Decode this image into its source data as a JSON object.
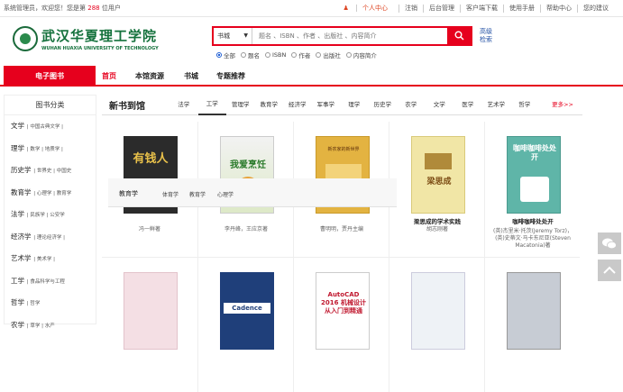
{
  "topbar": {
    "welcome_prefix": "系统管理员，欢迎您！您是第",
    "visit_count": "288",
    "welcome_suffix": "位用户",
    "links": [
      "个人中心",
      "注销",
      "后台管理",
      "客户端下载",
      "使用手册",
      "帮助中心",
      "您的建议"
    ]
  },
  "logo": {
    "name_cn": "武汉华夏理工学院",
    "name_en": "WUHAN HUAXIA UNIVERSITY OF TECHNOLOGY"
  },
  "search": {
    "type_selected": "书城",
    "placeholder": "题名 、ISBN 、作者 、出版社 、内容简介",
    "advanced_label": "高级检索",
    "radio_options": [
      "全部",
      "题名",
      "ISBN",
      "作者",
      "出版社",
      "内容简介"
    ],
    "radio_selected": "全部"
  },
  "nav": {
    "ebook_label": "电子图书",
    "items": [
      "首页",
      "本馆资源",
      "书城",
      "专题推荐"
    ]
  },
  "sidebar": {
    "title": "图书分类",
    "categories": [
      {
        "name": "文学",
        "subs": "中国古典文学"
      },
      {
        "name": "理学",
        "subs": "数学 | 地质学"
      },
      {
        "name": "历史学",
        "subs": "世界史 | 中国史"
      },
      {
        "name": "教育学",
        "subs": "心理学 | 教育学"
      },
      {
        "name": "法学",
        "subs": "民族学 | 公安学"
      },
      {
        "name": "经济学",
        "subs": "理论经济学"
      },
      {
        "name": "艺术学",
        "subs": "美术学"
      },
      {
        "name": "工学",
        "subs": "食品科学与工程"
      },
      {
        "name": "哲学",
        "subs": "哲学"
      },
      {
        "name": "农学",
        "subs": "草学 | 水产"
      }
    ]
  },
  "new_books": {
    "label": "新书到馆",
    "tabs": [
      "法学",
      "工学",
      "管理学",
      "教育学",
      "经济学",
      "军事学",
      "理学",
      "历史学",
      "农学",
      "文学",
      "医学",
      "艺术学",
      "哲学"
    ],
    "active_tab": "工学",
    "more_label": "更多>>",
    "books": [
      {
        "title": "",
        "author": "冯一鲜著"
      },
      {
        "title": "",
        "author": "李丹峰，王应京著"
      },
      {
        "title": "",
        "author": "曹明明，贾丹主编"
      },
      {
        "title": "梁思成的学术实践",
        "author": "胡志刚著"
      },
      {
        "title": "咖啡咖啡处处开",
        "author": "(英)杰里米·托茨(Jeremy Torz)，(英)史蒂文·马卡东尼亚(Steven Macatonia)著"
      }
    ],
    "book_covers_row1": [
      "有钱人",
      "我爱烹饪",
      "新农家的新世界",
      "梁思成",
      "咖啡咖啡处处开"
    ],
    "book_covers_row2": [
      "",
      "Cadence",
      "AutoCAD 2016 机械设计从入门到精通",
      "",
      ""
    ]
  },
  "overlay": {
    "heading": "教育学",
    "subs": [
      "体育学",
      "教育学",
      "心理学"
    ]
  },
  "colors": {
    "brand_red": "#e6001d",
    "logo_green": "#14713c",
    "link_blue": "#1f4ea3"
  }
}
